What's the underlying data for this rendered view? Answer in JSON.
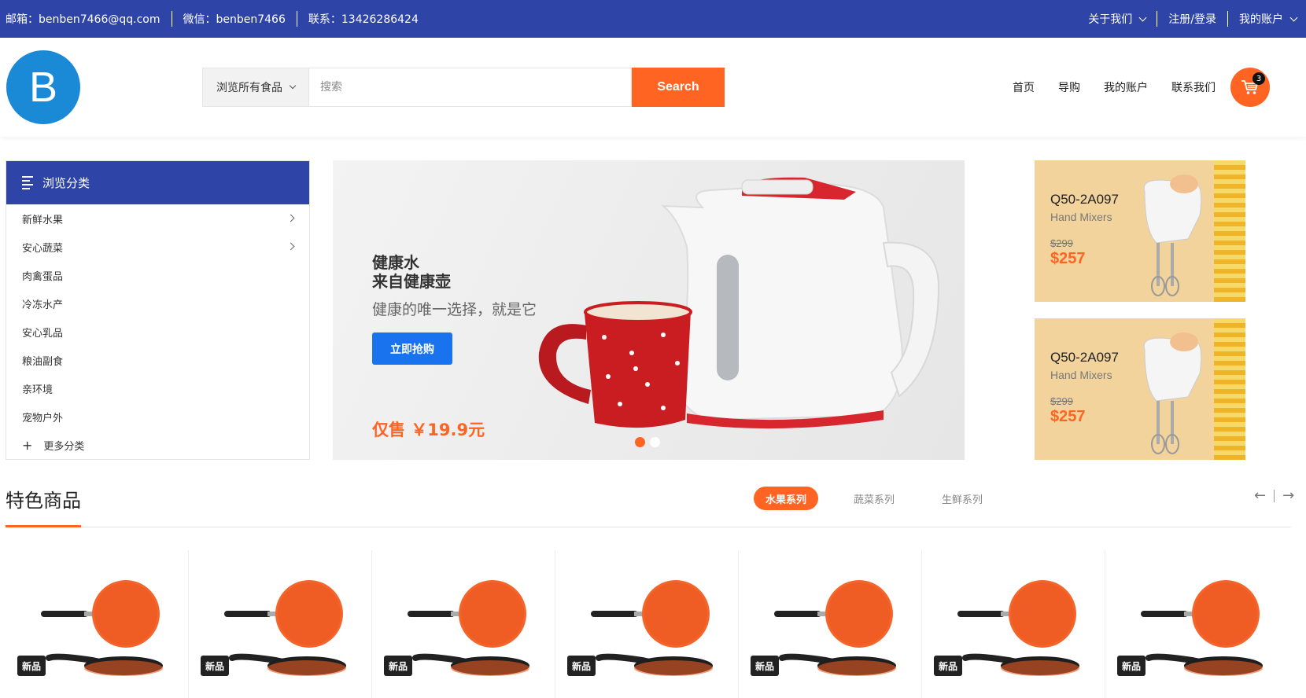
{
  "topbar": {
    "email": "邮箱：benben7466@qq.com",
    "wechat": "微信：benben7466",
    "phone": "联系：13426286424",
    "about": "关于我们",
    "login": "注册/登录",
    "account": "我的账户"
  },
  "header": {
    "logo_letter": "B",
    "category_select": "浏览所有食品",
    "search_placeholder": "搜索",
    "search_button": "Search",
    "nav": [
      "首页",
      "导购",
      "我的账户",
      "联系我们"
    ],
    "cart_count": "3"
  },
  "sidebar": {
    "title": "浏览分类",
    "items": [
      "新鲜水果",
      "安心蔬菜",
      "肉禽蛋品",
      "冷冻水产",
      "安心乳品",
      "粮油副食",
      "亲环境",
      "宠物户外"
    ],
    "more": "更多分类"
  },
  "banner": {
    "line1": "健康水",
    "line2": "来自健康壶",
    "subtitle": "健康的唯一选择，就是它",
    "button": "立即抢购",
    "price": "仅售 ￥19.9元",
    "slides_total": 2,
    "active_slide": 1
  },
  "promos": [
    {
      "model": "Q50-2A097",
      "kind": "Hand Mixers",
      "old_price": "$299",
      "price": "$257"
    },
    {
      "model": "Q50-2A097",
      "kind": "Hand Mixers",
      "old_price": "$299",
      "price": "$257"
    }
  ],
  "featured": {
    "title": "特色商品",
    "tabs": [
      "水果系列",
      "蔬菜系列",
      "生鲜系列"
    ],
    "active_tab": 0,
    "product_tag": "新品",
    "product_count": 7
  },
  "colors": {
    "primary": "#2e44a7",
    "accent": "#ff6423",
    "button_blue": "#1a73ee",
    "logo": "#1a8ad6"
  }
}
